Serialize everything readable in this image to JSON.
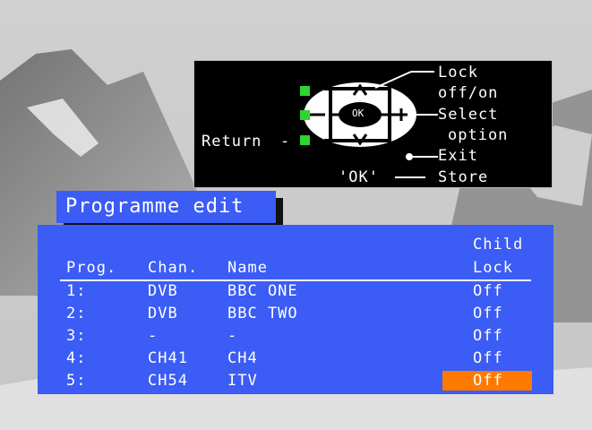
{
  "help": {
    "lock_line1": "Lock",
    "lock_line2": "off/on",
    "select_line1": "Select",
    "select_line2": "option",
    "exit": "Exit",
    "ok_key": "'OK'",
    "store": "Store",
    "return": "Return",
    "ok_button": "OK"
  },
  "panel": {
    "title": "Programme edit",
    "headers": {
      "prog": "Prog.",
      "chan": "Chan.",
      "name": "Name",
      "child_lock_line1": "Child",
      "child_lock_line2": "Lock"
    },
    "rows": [
      {
        "prog": "1:",
        "chan": "DVB",
        "name": "BBC ONE",
        "lock": "Off",
        "selected": false
      },
      {
        "prog": "2:",
        "chan": "DVB",
        "name": "BBC TWO",
        "lock": "Off",
        "selected": false
      },
      {
        "prog": "3:",
        "chan": "-",
        "name": "-",
        "lock": "Off",
        "selected": false
      },
      {
        "prog": "4:",
        "chan": "CH41",
        "name": "CH4",
        "lock": "Off",
        "selected": false
      },
      {
        "prog": "5:",
        "chan": "CH54",
        "name": "ITV",
        "lock": "Off",
        "selected": true
      }
    ]
  },
  "colors": {
    "panel": "#3b5cf5",
    "highlight": "#ff7a00",
    "indicator": "#2fd42f"
  }
}
